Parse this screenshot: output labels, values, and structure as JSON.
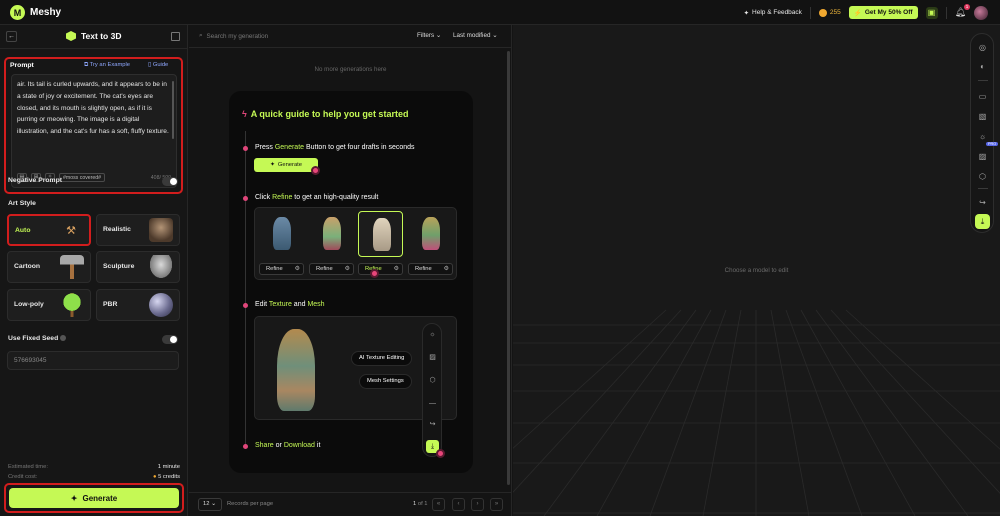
{
  "app": {
    "name": "Meshy"
  },
  "topbar": {
    "help_label": "Help & Feedback",
    "credits": "255",
    "promo_label": "Get My 50% Off",
    "notification_count": "1"
  },
  "left_panel": {
    "title": "Text to 3D",
    "prompt": {
      "label": "Prompt",
      "try_example": "Try an Example",
      "guide": "Guide",
      "text": "air. Its tail is curled upwards, and it appears to be in a state of joy or excitement. The cat's eyes are closed, and its mouth is slightly open, as if it is purring or meowing. The image is a digital illustration, and the cat's fur has a soft, fluffy texture.",
      "tag": "#moss covered#",
      "counter": "408/ 500"
    },
    "negative_prompt_label": "Negative Prompt",
    "art_style": {
      "label": "Art Style",
      "options": [
        {
          "label": "Auto",
          "active": true,
          "icon": "magic-wand-icon"
        },
        {
          "label": "Realistic",
          "active": false,
          "icon": "realistic-thumb"
        },
        {
          "label": "Cartoon",
          "active": false,
          "icon": "hammer-thumb"
        },
        {
          "label": "Sculpture",
          "active": false,
          "icon": "sculpture-thumb"
        },
        {
          "label": "Low-poly",
          "active": false,
          "icon": "tree-thumb"
        },
        {
          "label": "PBR",
          "active": false,
          "icon": "sphere-thumb"
        }
      ]
    },
    "fixed_seed_label": "Use Fixed Seed",
    "seed_value": "576693045",
    "estimated_time_label": "Estimated time:",
    "estimated_time_value": "1 minute",
    "credit_cost_label": "Credit cost:",
    "credit_cost_value": "5 credits",
    "generate_label": "Generate"
  },
  "middle_panel": {
    "search_placeholder": "Search my generation",
    "filters_label": "Filters",
    "sort_label": "Last modified",
    "empty_message": "No more generations here",
    "guide": {
      "title": "A quick guide to help you get started",
      "step1": {
        "pre": "Press ",
        "hl": "Generate",
        "post": " Button to get four drafts in seconds",
        "button": "Generate"
      },
      "step2": {
        "pre": "Click ",
        "hl": "Refine",
        "post": " to get an high-quality result",
        "button": "Refine"
      },
      "step3": {
        "pre": "Edit ",
        "hl1": "Texture",
        "mid": " and ",
        "hl2": "Mesh",
        "chip1": "AI Texture Editing",
        "chip2": "Mesh Settings"
      },
      "step4": {
        "hl1": "Share",
        "mid": " or ",
        "hl2": "Download",
        "post": " it"
      }
    },
    "pager": {
      "per_page": "12",
      "per_page_label": "Records per page",
      "current_page": "1",
      "of_label": "of 1"
    }
  },
  "viewport": {
    "message": "Choose a model to edit",
    "pro_badge": "PRO"
  },
  "colors": {
    "accent": "#c5f955",
    "highlight_outline": "#d21d1d",
    "cursor_pink": "#e8467a"
  }
}
